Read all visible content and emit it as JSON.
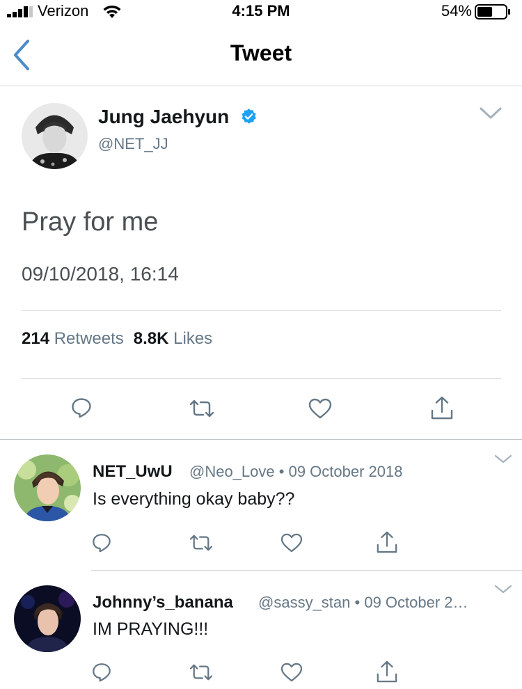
{
  "status_bar": {
    "carrier": "Verizon",
    "time": "4:15 PM",
    "battery": "54%",
    "battery_level": 0.54,
    "icons": [
      "signal-bars-icon",
      "wifi-icon",
      "battery-icon"
    ]
  },
  "nav": {
    "title": "Tweet",
    "back_icon": "chevron-left-icon"
  },
  "tweet": {
    "author_name": "Jung Jaehyun",
    "verified": true,
    "handle": "@NET_JJ",
    "text": "Pray for me",
    "timestamp": "09/10/2018, 16:14",
    "retweets_count": "214",
    "retweets_label": "Retweets",
    "likes_count": "8.8K",
    "likes_label": "Likes"
  },
  "replies": [
    {
      "name": "NET_UwU",
      "handle": "@Neo_Love",
      "date_meta": "• 09 October 2018",
      "text": "Is everything okay baby??"
    },
    {
      "name": "Johnny’s_banana",
      "handle": "@sassy_stan",
      "date_meta": "• 09 October 2…",
      "text": "IM PRAYING!!!"
    }
  ],
  "colors": {
    "twitter_blue": "#1da1f2",
    "back_blue": "#4a8bc9",
    "secondary_text": "#657786",
    "icon_gray": "#657786"
  }
}
